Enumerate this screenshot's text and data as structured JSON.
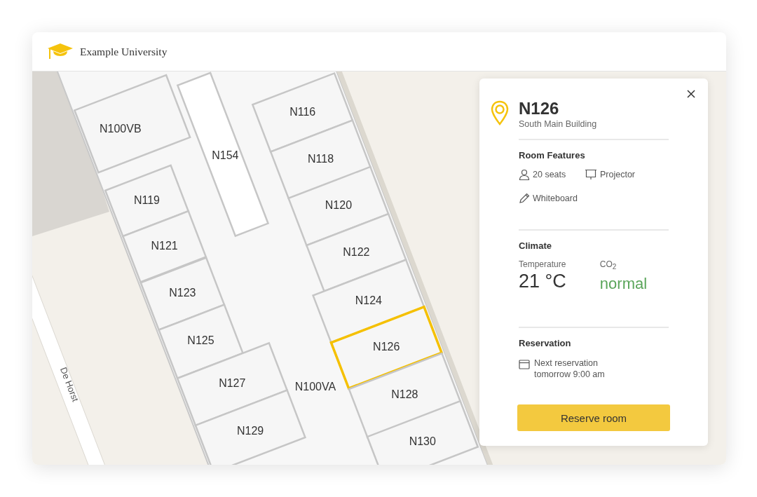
{
  "header": {
    "brand": "Example University"
  },
  "map": {
    "rooms": [
      {
        "label": "N100VB",
        "selected": false
      },
      {
        "label": "N154",
        "selected": false
      },
      {
        "label": "N116",
        "selected": false
      },
      {
        "label": "N118",
        "selected": false
      },
      {
        "label": "N119",
        "selected": false
      },
      {
        "label": "N120",
        "selected": false
      },
      {
        "label": "N121",
        "selected": false
      },
      {
        "label": "N122",
        "selected": false
      },
      {
        "label": "N123",
        "selected": false
      },
      {
        "label": "N124",
        "selected": false
      },
      {
        "label": "N125",
        "selected": false
      },
      {
        "label": "N126",
        "selected": true
      },
      {
        "label": "N127",
        "selected": false
      },
      {
        "label": "N128",
        "selected": false
      },
      {
        "label": "N129",
        "selected": false
      },
      {
        "label": "N130",
        "selected": false
      }
    ],
    "corridor_label": "N100VA",
    "street": "De Horst"
  },
  "panel": {
    "title": "N126",
    "subtitle": "South Main Building",
    "features_heading": "Room Features",
    "features": [
      {
        "kind": "seats",
        "label": "20 seats"
      },
      {
        "kind": "projector",
        "label": "Projector"
      },
      {
        "kind": "whiteboard",
        "label": "Whiteboard"
      }
    ],
    "climate": {
      "heading": "Climate",
      "temperature_label": "Temperature",
      "temperature": "21 °C",
      "co2_label": "CO$_{2}$",
      "co2": "normal"
    },
    "reservation": {
      "heading": "Reservation",
      "label": "Next reservation",
      "time": "tomorrow 9:00 am"
    },
    "button": "Reserve room"
  }
}
